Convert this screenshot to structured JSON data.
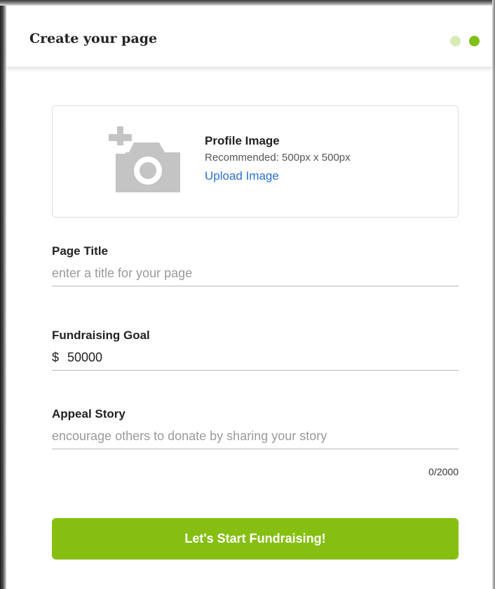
{
  "header": {
    "title": "Create your page",
    "steps": [
      "step-1",
      "step-2"
    ],
    "active_step": 2
  },
  "profile_image": {
    "title": "Profile Image",
    "recommendation": "Recommended: 500px x 500px",
    "upload_label": "Upload Image",
    "icon": "add-photo-icon"
  },
  "page_title": {
    "label": "Page Title",
    "placeholder": "enter a title for your page",
    "value": ""
  },
  "goal": {
    "label": "Fundraising Goal",
    "currency": "$",
    "value": "50000"
  },
  "story": {
    "label": "Appeal Story",
    "placeholder": "encourage others to donate by sharing your story",
    "value": "",
    "char_count": "0/2000"
  },
  "cta": {
    "label": "Let's Start Fundraising!"
  },
  "colors": {
    "accent": "#86bf12",
    "dot_active": "#7fbf16",
    "dot_inactive": "#d7ecb4",
    "link": "#2a72d6"
  }
}
